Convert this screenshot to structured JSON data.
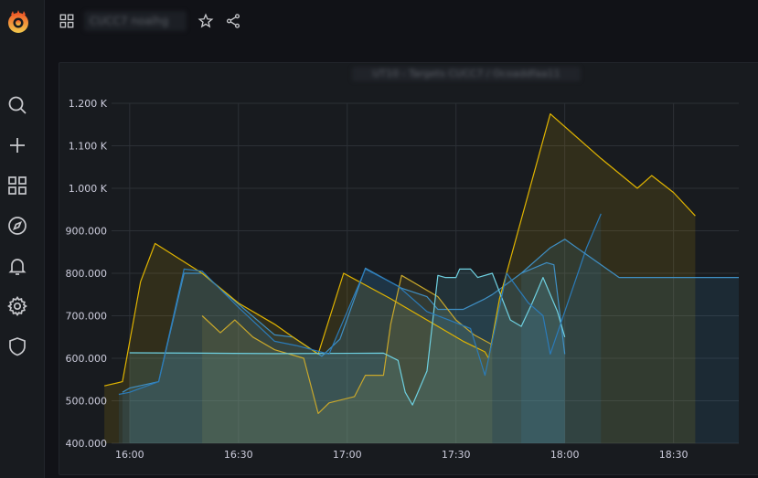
{
  "app": {
    "logo_icon": "grafana-logo-icon"
  },
  "sidebar": {
    "items": [
      {
        "name": "search",
        "icon": "search-icon"
      },
      {
        "name": "create",
        "icon": "plus-icon"
      },
      {
        "name": "dashboards",
        "icon": "grid-icon"
      },
      {
        "name": "explore",
        "icon": "compass-icon"
      },
      {
        "name": "alerting",
        "icon": "bell-icon"
      },
      {
        "name": "configuration",
        "icon": "gear-icon"
      },
      {
        "name": "server-admin",
        "icon": "shield-icon"
      }
    ]
  },
  "header": {
    "title": "CUCC7 noalhg"
  },
  "panel": {
    "title": "UT10 - Targets CUCC7 / Ocoaddfaa11"
  },
  "colors": {
    "background": "#111217",
    "panel": "#181b1f",
    "grid": "#2c3036",
    "series": [
      "#3f8fc4",
      "#e0b400",
      "#c9a82b",
      "#6ed0e0",
      "#2b7bb9"
    ]
  },
  "chart_data": {
    "type": "area",
    "x_unit": "time (HH:MM)",
    "x_range": [
      "15:55",
      "18:48"
    ],
    "ylim": [
      400,
      1200
    ],
    "yticks": [
      "400.000",
      "500.000",
      "600.000",
      "700.000",
      "800.000",
      "900.000",
      "1.000 K",
      "1.100 K",
      "1.200 K"
    ],
    "xticks": [
      "16:00",
      "16:30",
      "17:00",
      "17:30",
      "18:00",
      "18:30"
    ],
    "grid": true,
    "legend": "none",
    "series": [
      {
        "points": [
          [
            "15:58",
            520
          ],
          [
            "16:00",
            530
          ],
          [
            "16:08",
            545
          ],
          [
            "16:15",
            800
          ],
          [
            "16:20",
            800
          ],
          [
            "16:40",
            655
          ],
          [
            "16:45",
            650
          ],
          [
            "16:53",
            605
          ],
          [
            "16:58",
            645
          ],
          [
            "17:05",
            812
          ],
          [
            "17:15",
            765
          ],
          [
            "17:22",
            745
          ],
          [
            "17:25",
            715
          ],
          [
            "17:32",
            715
          ],
          [
            "17:38",
            740
          ],
          [
            "17:40",
            750
          ],
          [
            "17:48",
            800
          ],
          [
            "17:55",
            825
          ],
          [
            "17:57",
            820
          ],
          [
            "17:60",
            610
          ]
        ]
      },
      {
        "points": [
          [
            "15:53",
            535
          ],
          [
            "15:58",
            545
          ],
          [
            "16:03",
            780
          ],
          [
            "16:07",
            870
          ],
          [
            "16:20",
            800
          ],
          [
            "16:30",
            730
          ],
          [
            "16:40",
            680
          ],
          [
            "16:45",
            650
          ],
          [
            "16:52",
            610
          ],
          [
            "16:59",
            800
          ],
          [
            "17:12",
            740
          ],
          [
            "17:22",
            690
          ],
          [
            "17:32",
            640
          ],
          [
            "17:38",
            615
          ],
          [
            "17:39",
            600
          ],
          [
            "17:42",
            740
          ],
          [
            "17:56",
            1175
          ],
          [
            "18:10",
            1070
          ],
          [
            "18:20",
            1000
          ],
          [
            "18:24",
            1030
          ],
          [
            "18:30",
            990
          ],
          [
            "18:36",
            935
          ]
        ]
      },
      {
        "points": [
          [
            "16:20",
            700
          ],
          [
            "16:25",
            660
          ],
          [
            "16:29",
            690
          ],
          [
            "16:34",
            650
          ],
          [
            "16:40",
            620
          ],
          [
            "16:48",
            600
          ],
          [
            "16:52",
            470
          ],
          [
            "16:55",
            495
          ],
          [
            "17:02",
            510
          ],
          [
            "17:05",
            560
          ],
          [
            "17:10",
            560
          ],
          [
            "17:12",
            680
          ],
          [
            "17:15",
            795
          ],
          [
            "17:25",
            745
          ],
          [
            "17:30",
            690
          ],
          [
            "17:35",
            655
          ],
          [
            "17:40",
            632
          ]
        ]
      },
      {
        "points": [
          [
            "16:00",
            613
          ],
          [
            "16:20",
            612
          ],
          [
            "16:40",
            611
          ],
          [
            "17:10",
            612
          ],
          [
            "17:14",
            595
          ],
          [
            "17:16",
            520
          ],
          [
            "17:18",
            490
          ],
          [
            "17:22",
            570
          ],
          [
            "17:25",
            795
          ],
          [
            "17:27",
            790
          ],
          [
            "17:30",
            790
          ],
          [
            "17:31",
            810
          ],
          [
            "17:34",
            810
          ],
          [
            "17:36",
            790
          ],
          [
            "17:40",
            800
          ],
          [
            "17:45",
            690
          ],
          [
            "17:48",
            675
          ],
          [
            "17:51",
            730
          ],
          [
            "17:54",
            790
          ],
          [
            "17:58",
            710
          ],
          [
            "18:00",
            650
          ]
        ]
      },
      {
        "points": [
          [
            "15:57",
            515
          ],
          [
            "16:00",
            520
          ],
          [
            "16:08",
            545
          ],
          [
            "16:15",
            810
          ],
          [
            "16:20",
            805
          ],
          [
            "16:30",
            720
          ],
          [
            "16:40",
            640
          ],
          [
            "16:46",
            630
          ],
          [
            "16:55",
            610
          ],
          [
            "17:05",
            810
          ],
          [
            "17:14",
            770
          ],
          [
            "17:22",
            710
          ],
          [
            "17:28",
            690
          ],
          [
            "17:34",
            670
          ],
          [
            "17:38",
            560
          ],
          [
            "17:44",
            800
          ],
          [
            "17:50",
            730
          ],
          [
            "17:54",
            700
          ],
          [
            "17:56",
            610
          ],
          [
            "18:06",
            860
          ],
          [
            "18:10",
            940
          ]
        ]
      },
      {
        "points": [
          [
            "17:48",
            800
          ],
          [
            "17:56",
            860
          ],
          [
            "18:00",
            880
          ],
          [
            "18:15",
            790
          ],
          [
            "18:48",
            790
          ]
        ]
      }
    ]
  }
}
